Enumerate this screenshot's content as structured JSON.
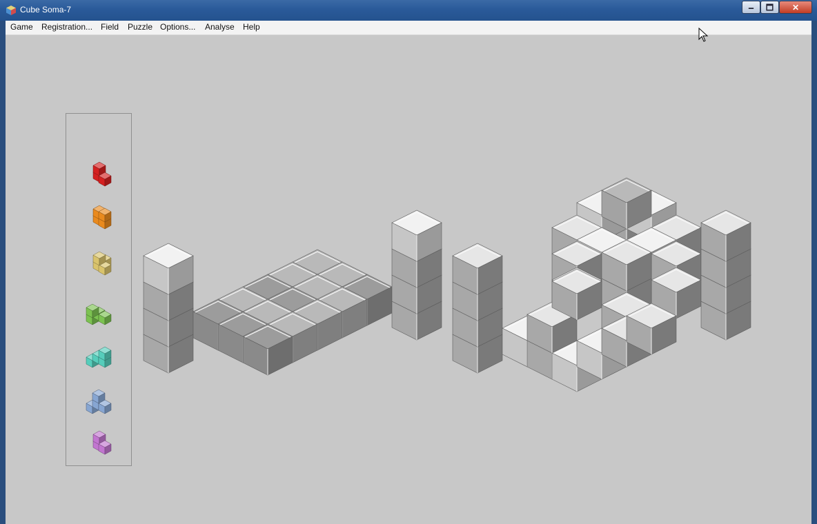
{
  "window": {
    "title": "Cube Soma-7",
    "minimize_label": "🗕",
    "maximize_label": "🗖",
    "close_label": "✕"
  },
  "menu": [
    {
      "label": "Game"
    },
    {
      "label": "Registration..."
    },
    {
      "label": "Field"
    },
    {
      "label": "Puzzle"
    },
    {
      "label": "Options..."
    },
    {
      "label": "Analyse"
    },
    {
      "label": "Help"
    }
  ],
  "pieces": [
    {
      "name": "red",
      "color": "#d42020"
    },
    {
      "name": "orange",
      "color": "#e98a1e"
    },
    {
      "name": "yellow",
      "color": "#d9c36c"
    },
    {
      "name": "green",
      "color": "#7cc251"
    },
    {
      "name": "teal",
      "color": "#56cdbb"
    },
    {
      "name": "blue",
      "color": "#87a6d2"
    },
    {
      "name": "violet",
      "color": "#c276d0"
    }
  ],
  "icons": {
    "app": "cube-app-icon",
    "cursor": "mouse-cursor-icon"
  },
  "colors": {
    "titlebar": "#2a5a99",
    "client": "#c8c8c8",
    "cube_top": "#e6e6e6",
    "cube_left": "#a8a8a8",
    "cube_right": "#7a7a7a"
  }
}
